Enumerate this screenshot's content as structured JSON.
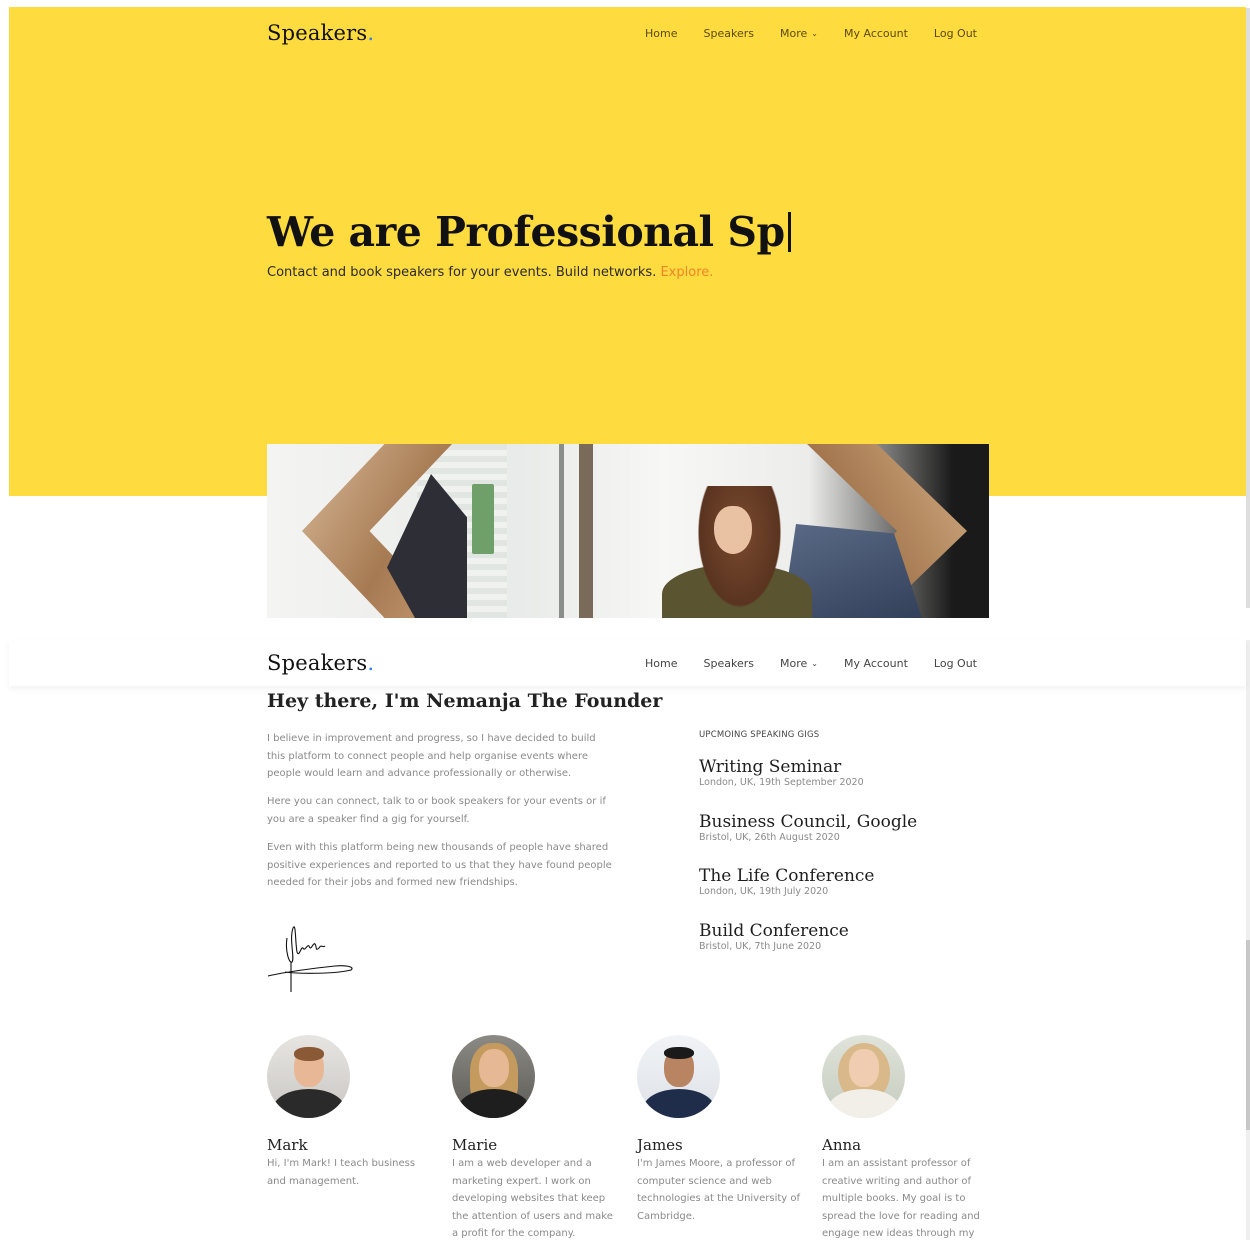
{
  "brand": {
    "name": "Speakers",
    "dot": "."
  },
  "nav": {
    "items": [
      "Home",
      "Speakers",
      "More",
      "My Account",
      "Log Out"
    ],
    "more_chevron_icon": "chevron-down-icon"
  },
  "hero": {
    "title": "We are Professional Sp",
    "subtitle": "Contact and book speakers for your events. Build networks.",
    "explore_link": "Explore.",
    "background_color": "#fedb3e",
    "accent_color": "#f0842a"
  },
  "founder": {
    "title": "Hey there, I'm Nemanja The Founder",
    "paragraphs": [
      "I believe in improvement and progress, so I have decided to build this platform to connect people and help organise events where people would learn and advance professionally or otherwise.",
      "Here you can connect, talk to or book speakers for your events or if you are a speaker find a gig for yourself.",
      "Even with this platform being new thousands of people have shared positive experiences and reported to us that they have found people needed for their jobs and formed new friendships."
    ]
  },
  "gigs": {
    "heading": "UPCMOING SPEAKING GIGS",
    "items": [
      {
        "title": "Writing Seminar",
        "meta": "London, UK, 19th September 2020"
      },
      {
        "title": "Business Council, Google",
        "meta": "Bristol, UK, 26th August 2020"
      },
      {
        "title": "The Life Conference",
        "meta": "London, UK, 19th July 2020"
      },
      {
        "title": "Build Conference",
        "meta": "Bristol, UK, 7th June 2020"
      }
    ]
  },
  "speakers": [
    {
      "name": "Mark",
      "bio": "Hi, I'm Mark! I teach business and management."
    },
    {
      "name": "Marie",
      "bio": "I am a web developer and a marketing expert. I work on developing websites that keep the attention of users and make a profit for the company."
    },
    {
      "name": "James",
      "bio": "I'm James Moore, a professor of computer science and web technologies at the University of Cambridge."
    },
    {
      "name": "Anna",
      "bio": "I am an assistant professor of creative writing and author of multiple books. My goal is to spread the love for reading and engage new ideas through my"
    }
  ]
}
